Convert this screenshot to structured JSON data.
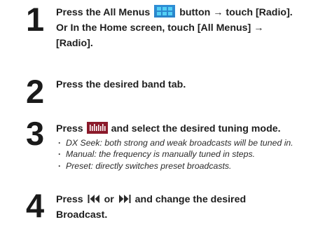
{
  "steps": [
    {
      "number": "1",
      "lines": {
        "l1_before": "Press the All Menus",
        "l1_icon": "all-menus-icon",
        "l1_after": "button → touch [Radio].",
        "l2": "Or In the Home screen, touch [All Menus] →",
        "l3": "[Radio]."
      }
    },
    {
      "number": "2",
      "text": "Press the desired band tab."
    },
    {
      "number": "3",
      "before": "Press",
      "icon": "tuning-mode-icon",
      "after": "and select the desired tuning mode.",
      "bullets": [
        "DX Seek: both strong and weak broadcasts will be tuned in.",
        "Manual: the frequency is manually tuned in steps.",
        "Preset: directly switches preset broadcasts."
      ]
    },
    {
      "number": "4",
      "before": "Press",
      "seek_back_icon": "seek-back-icon",
      "middle": "or",
      "seek_forward_icon": "seek-forward-icon",
      "after": "and change the desired",
      "line2": "Broadcast."
    }
  ],
  "colors": {
    "text": "#1e1e1e",
    "all_menus_icon_bg": "#2f8fd6",
    "all_menus_icon_cells": "#55d0f5",
    "tuning_icon_bg": "#8b1a2b",
    "seek_icon": "#2a2a2a"
  }
}
